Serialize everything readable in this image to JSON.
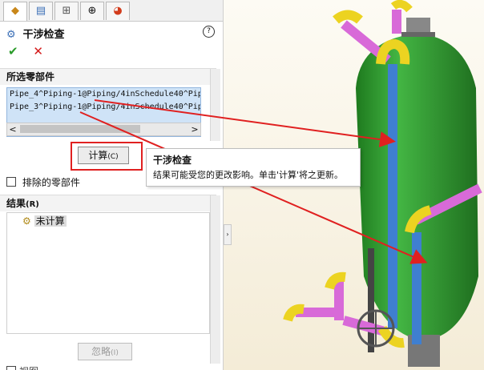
{
  "feature": {
    "title": "干涉检查",
    "help": "?"
  },
  "actions": {
    "ok": "✔",
    "cancel": "✕"
  },
  "selected": {
    "header": "所选零部件",
    "items": [
      "Pipe_4^Piping-1@Piping/4inSchedule40^Pipe_4_Pipi",
      "Pipe_3^Piping-1@Piping/4inSchedule40^Pipe_3_Pipi"
    ],
    "scroll_left": "<",
    "scroll_right": ">"
  },
  "calc_button": {
    "label": "计算",
    "shortcut": "(C)"
  },
  "exclude": {
    "label": "排除的零部件"
  },
  "results": {
    "header": "结果",
    "shortcut": "(R)",
    "item": "未计算"
  },
  "ignore_button": {
    "label": "忽略",
    "shortcut": "(I)"
  },
  "bottom_label": "视图",
  "tooltip": {
    "title": "干涉检查",
    "body": "结果可能受您的更改影响。单击'计算'将之更新。"
  },
  "colors": {
    "vessel": "#2f9d2f",
    "pipe_blue": "#3f7fd0",
    "pipe_pink": "#d86ad8",
    "elbow_yellow": "#ecd321",
    "annotation_red": "#e02020"
  }
}
